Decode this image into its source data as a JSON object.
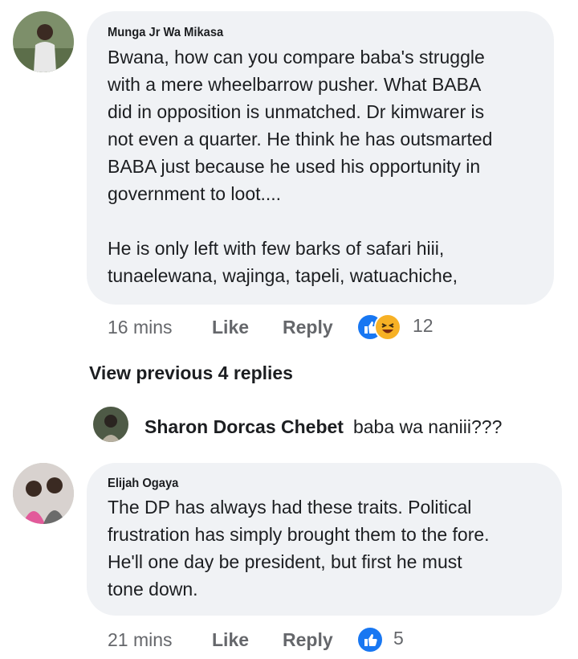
{
  "comments": [
    {
      "author": "Munga Jr Wa Mikasa",
      "text": "Bwana, how can you compare baba's struggle\nwith a mere wheelbarrow pusher. What BABA\ndid in opposition is unmatched. Dr kimwarer is\nnot even a quarter. He think he has outsmarted\nBABA just because he used his opportunity in\ngovernment to loot....\n\nHe is only left with few barks of safari hiii,\ntunaelewana,  wajinga, tapeli, watuachiche,",
      "time": "16 mins",
      "like_label": "Like",
      "reply_label": "Reply",
      "reactions": [
        "like-icon",
        "haha-icon"
      ],
      "reaction_count": "12"
    },
    {
      "author": "Elijah Ogaya",
      "text": "The DP has always had these traits. Political\nfrustration has simply brought them to the fore.\nHe'll one day be president, but first he must\ntone down.",
      "time": "21 mins",
      "like_label": "Like",
      "reply_label": "Reply",
      "reactions": [
        "like-icon"
      ],
      "reaction_count": "5"
    }
  ],
  "view_previous_replies": "View previous 4 replies",
  "reply_preview": {
    "author": "Sharon Dorcas Chebet",
    "text": "baba wa naniii???"
  },
  "colors": {
    "bubble": "#f0f2f5",
    "meta_text": "#65676b",
    "like_blue": "#1877f2",
    "haha_yellow": "#f7b125"
  }
}
